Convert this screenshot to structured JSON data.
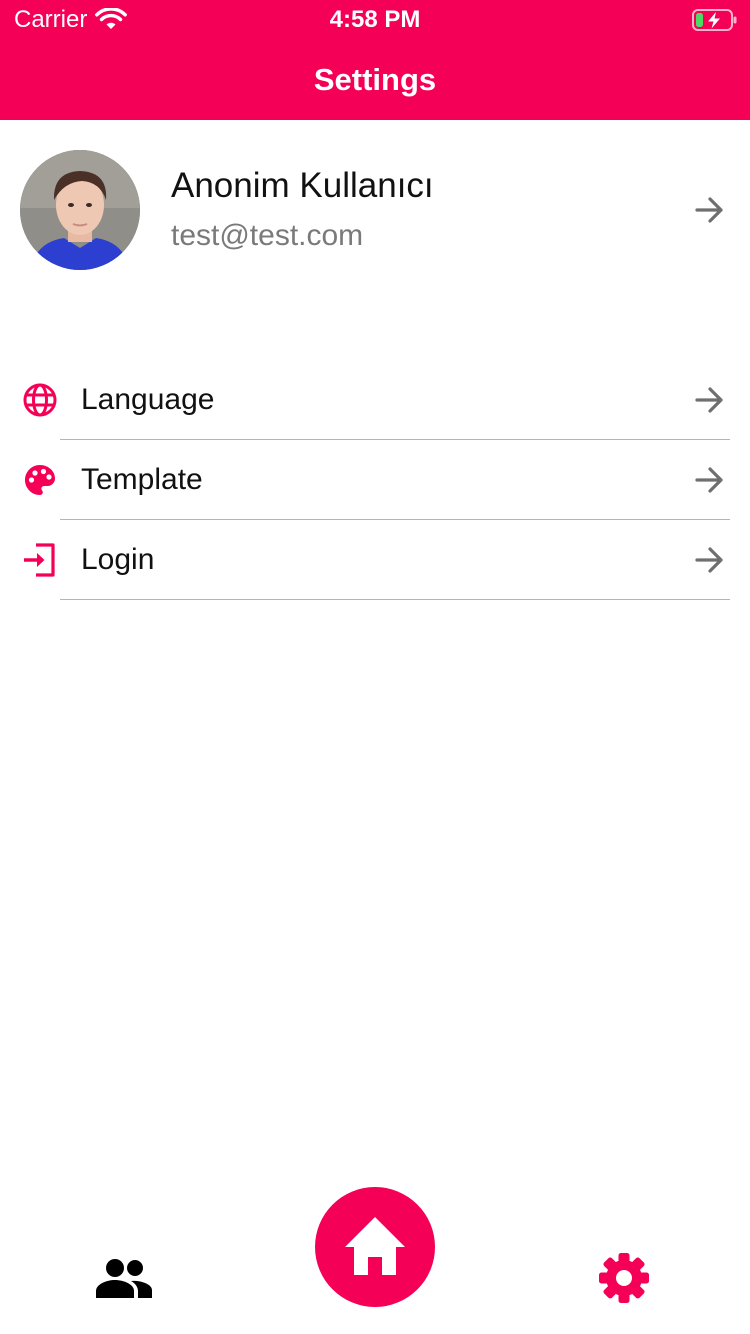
{
  "status_bar": {
    "carrier": "Carrier",
    "time": "4:58 PM",
    "icons": [
      "wifi-icon",
      "battery-charging-icon"
    ]
  },
  "header": {
    "title": "Settings",
    "background_color": "#F50057"
  },
  "profile": {
    "name": "Anonim Kullanıcı",
    "email": "test@test.com",
    "icons": [
      "avatar-photo",
      "arrow-right-icon"
    ]
  },
  "menu": {
    "items": [
      {
        "label": "Language",
        "icon": "globe-icon"
      },
      {
        "label": "Template",
        "icon": "palette-icon"
      },
      {
        "label": "Login",
        "icon": "login-icon"
      }
    ],
    "icon_color": "#F50057",
    "arrow_color": "#6f6f6f"
  },
  "tabbar": {
    "items": [
      {
        "name": "people",
        "icon": "people-icon",
        "color": "#000000"
      },
      {
        "name": "home",
        "icon": "home-icon",
        "color": "#F50057"
      },
      {
        "name": "settings",
        "icon": "gear-icon",
        "color": "#F50057",
        "active": true
      }
    ]
  }
}
